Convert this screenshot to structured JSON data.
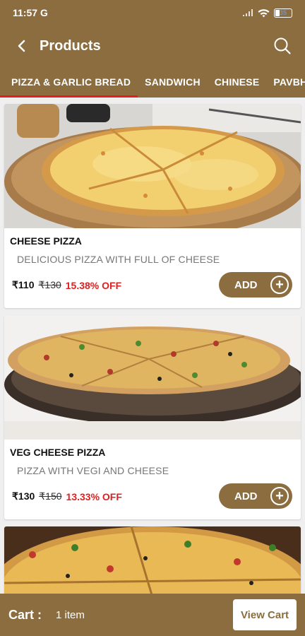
{
  "status_bar": {
    "time": "11:57",
    "carrier_icon": "G",
    "battery": "35"
  },
  "app_bar": {
    "title": "Products"
  },
  "tabs": [
    {
      "label": "PIZZA & GARLIC BREAD",
      "active": true
    },
    {
      "label": "SANDWICH",
      "active": false
    },
    {
      "label": "CHINESE",
      "active": false
    },
    {
      "label": "PAVBH",
      "active": false
    }
  ],
  "products": [
    {
      "name": "CHEESE PIZZA",
      "description": "DELICIOUS PIZZA WITH FULL OF CHEESE",
      "price": "₹110",
      "mrp": "₹130",
      "discount": "15.38% OFF",
      "add_label": "ADD"
    },
    {
      "name": "VEG CHEESE PIZZA",
      "description": "PIZZA WITH VEGI AND CHEESE",
      "price": "₹130",
      "mrp": "₹150",
      "discount": "13.33% OFF",
      "add_label": "ADD"
    }
  ],
  "cart": {
    "label": "Cart :",
    "count": "1 item",
    "view_label": "View Cart"
  },
  "colors": {
    "primary": "#8b6d3f",
    "accent": "#e02020",
    "background": "#efefef"
  }
}
